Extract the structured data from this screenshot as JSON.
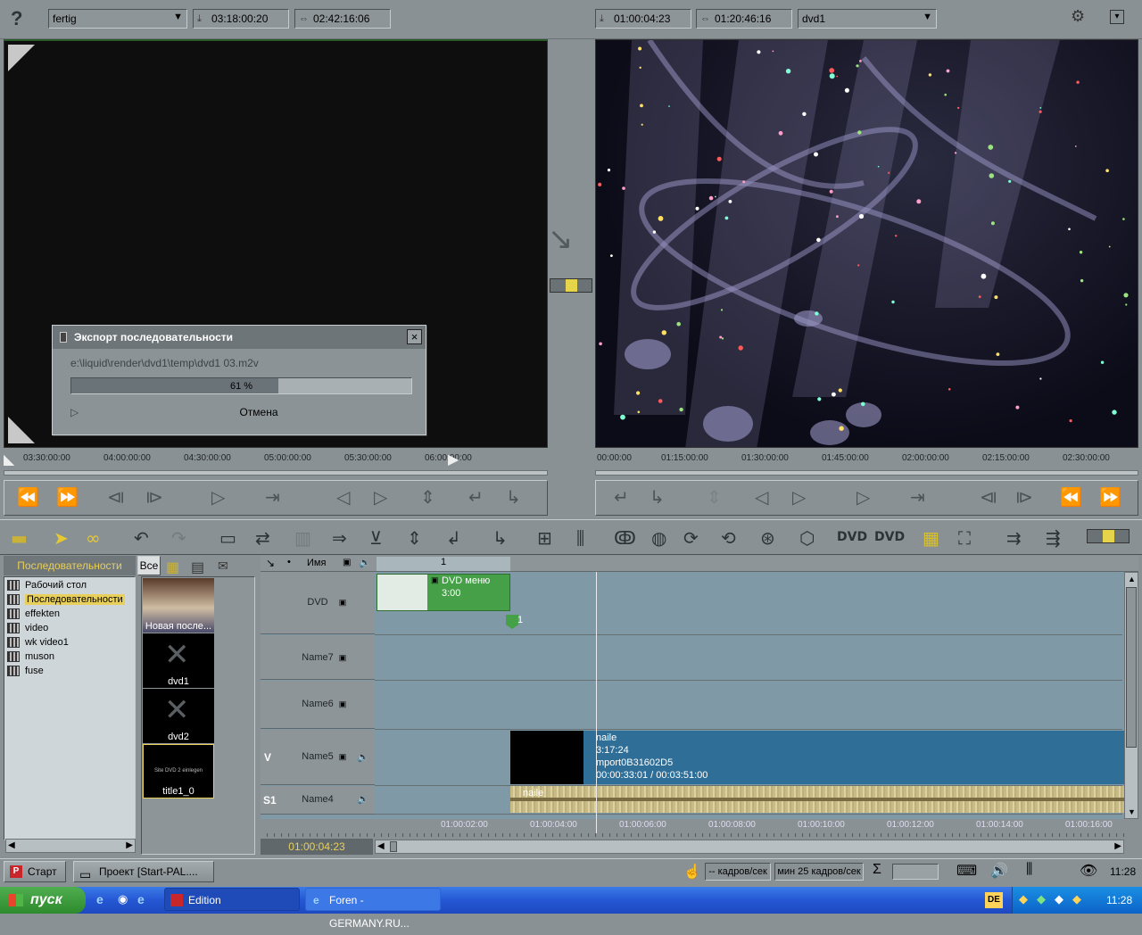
{
  "top_left": {
    "help_icon": "?",
    "source_dropdown": "fertig",
    "tc_in": "03:18:00:20",
    "tc_dur": "02:42:16:06"
  },
  "top_right": {
    "tc_in": "01:00:04:23",
    "tc_dur": "01:20:46:16",
    "seq_dropdown": "dvd1"
  },
  "dialog": {
    "title": "Экспорт последовательности",
    "path": "e:\\liquid\\render\\dvd1\\temp\\dvd1 03.m2v",
    "progress_text": "61 %",
    "progress": 0.61,
    "cancel": "Отмена"
  },
  "left_ruler": [
    "03:30:00:00",
    "04:00:00:00",
    "04:30:00:00",
    "05:00:00:00",
    "05:30:00:00",
    "06:00:00:00"
  ],
  "right_ruler": [
    "00:00:00",
    "01:15:00:00",
    "01:30:00:00",
    "01:45:00:00",
    "02:00:00:00",
    "02:15:00:00",
    "02:30:00:00"
  ],
  "browser": {
    "header": "Последовательности",
    "tab_all": "Все",
    "tree": [
      "Рабочий стол",
      "Последовательности",
      "effekten",
      "video",
      "wk video1",
      "muson",
      "fuse"
    ],
    "thumbs": [
      "Новая после...",
      "dvd1",
      "dvd2",
      "title1_0"
    ],
    "title_thumb_text": "Site DVD 2 einlegen"
  },
  "timeline": {
    "name_header": "Имя",
    "marker_num": "1",
    "tracks": [
      "DVD",
      "Name7",
      "Name6",
      "Name5",
      "Name4"
    ],
    "v_label": "V",
    "s1_label": "S1",
    "dvd_clip_title": "DVD меню",
    "dvd_clip_dur": "3:00",
    "chapter": "1",
    "video_clip": [
      "naile",
      "3:17:24",
      "mport0B31602D5",
      "00:00:33:01 / 00:03:51:00"
    ],
    "audio_clip": "naile",
    "timecode": "01:00:04:23",
    "ruler": [
      "01:00:02:00",
      "01:00:04:00",
      "01:00:06:00",
      "01:00:08:00",
      "01:00:10:00",
      "01:00:12:00",
      "01:00:14:00",
      "01:00:16:00"
    ]
  },
  "statusbar": {
    "start": "Старт",
    "project": "Проект [Start-PAL....",
    "fps": "-- кадров/сек",
    "min_fps": "мин 25 кадров/сек",
    "sigma": "Σ",
    "time": "11:28"
  },
  "taskbar": {
    "start": "пуск",
    "tasks": [
      "Edition",
      "Foren - GERMANY.RU..."
    ],
    "lang": "DE",
    "clock": "11:28"
  }
}
